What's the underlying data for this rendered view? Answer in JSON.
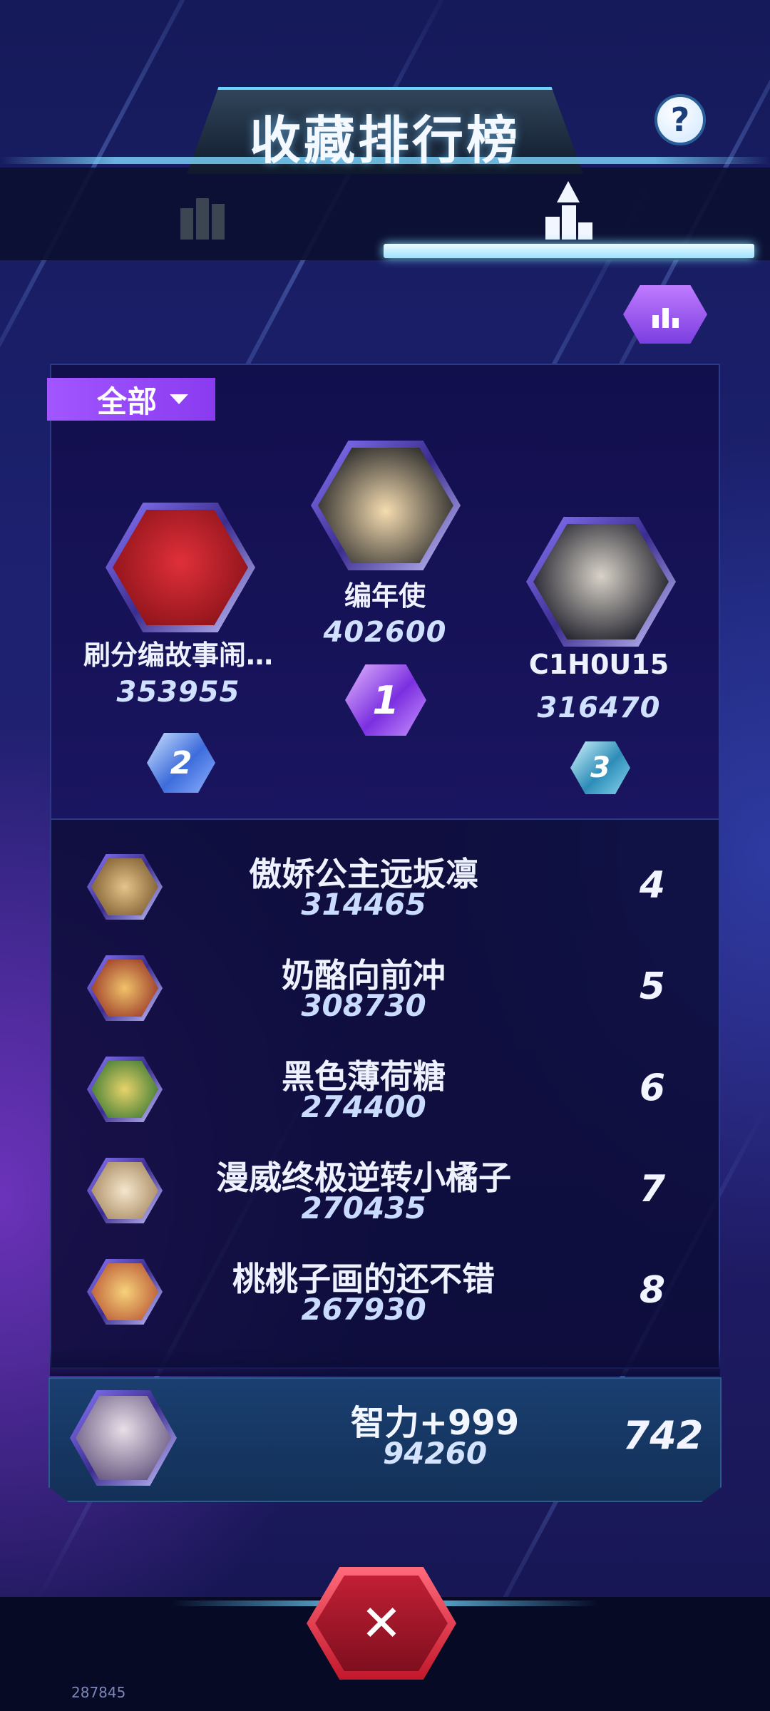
{
  "header": {
    "title": "收藏排行榜",
    "help_label": "?"
  },
  "tabs": [
    {
      "icon": "bar-chart-icon",
      "active": false
    },
    {
      "icon": "podium-icon",
      "active": true
    }
  ],
  "filter": {
    "label": "全部"
  },
  "podium": [
    {
      "rank": "2",
      "name": "刷分编故事闹…",
      "score": "353955",
      "avatar_color": "#b3121c"
    },
    {
      "rank": "1",
      "name": "编年使",
      "score": "402600",
      "avatar_color": "#f3d7a7"
    },
    {
      "rank": "3",
      "name": "C1H0U15",
      "score": "316470",
      "avatar_color": "#5a5a66"
    }
  ],
  "list": [
    {
      "rank": "4",
      "name": "傲娇公主远坂凛",
      "score": "314465",
      "avatar_color": "#b98c4a"
    },
    {
      "rank": "5",
      "name": "奶酪向前冲",
      "score": "308730",
      "avatar_color": "#c94a33"
    },
    {
      "rank": "6",
      "name": "黑色薄荷糖",
      "score": "274400",
      "avatar_color": "#2f8d3a"
    },
    {
      "rank": "7",
      "name": "漫威终极逆转小橘子",
      "score": "270435",
      "avatar_color": "#d8c2a0"
    },
    {
      "rank": "8",
      "name": "桃桃子画的还不错",
      "score": "267930",
      "avatar_color": "#d8a24a"
    }
  ],
  "my_entry": {
    "rank": "742",
    "name": "智力+999",
    "score": "94260",
    "avatar_color": "#9a8fb8"
  },
  "footer": {
    "close_label": "✕",
    "watermark": "287845"
  }
}
